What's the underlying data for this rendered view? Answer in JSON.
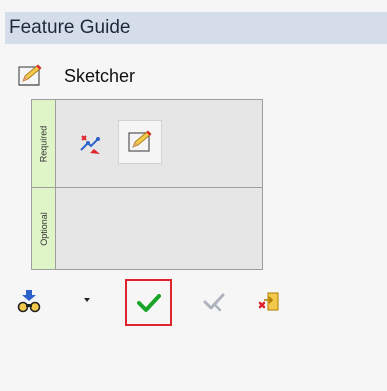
{
  "panel_title": "Feature Guide",
  "feature": {
    "name": "Sketcher",
    "icon": "sketcher-icon"
  },
  "tabs": {
    "required": "Required",
    "optional": "Optional"
  },
  "required_items": [
    {
      "icon": "sketch-constraint-icon"
    },
    {
      "icon": "sketcher-icon",
      "selected": true
    }
  ],
  "toolbar": [
    {
      "icon": "feature-tree-icon"
    },
    {
      "icon": "dropdown-arrow-icon"
    },
    {
      "icon": "check-icon",
      "highlighted": true
    },
    {
      "icon": "apply-icon",
      "disabled": true
    },
    {
      "icon": "close-exit-icon"
    }
  ],
  "colors": {
    "header_bg": "#d4dde9",
    "tab_bg": "#dff5c7",
    "highlight": "#e0242d",
    "check": "#1aa52a"
  }
}
